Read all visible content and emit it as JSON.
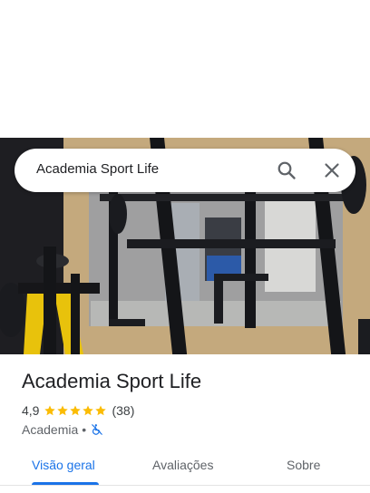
{
  "search": {
    "query": "Academia Sport Life"
  },
  "icons": {
    "search": "search-icon",
    "close": "close-icon",
    "accessibility": "no-wheelchair-icon",
    "star": "star-icon"
  },
  "place": {
    "name": "Academia Sport Life",
    "rating": "4,9",
    "stars": 5,
    "review_count": "(38)",
    "category": "Academia",
    "separator": "•"
  },
  "tabs": [
    {
      "label": "Visão geral",
      "active": true
    },
    {
      "label": "Avaliações",
      "active": false
    },
    {
      "label": "Sobre",
      "active": false
    }
  ],
  "colors": {
    "accent": "#1a73e8",
    "star": "#fbbc04",
    "text": "#202124",
    "muted": "#5f6368"
  }
}
